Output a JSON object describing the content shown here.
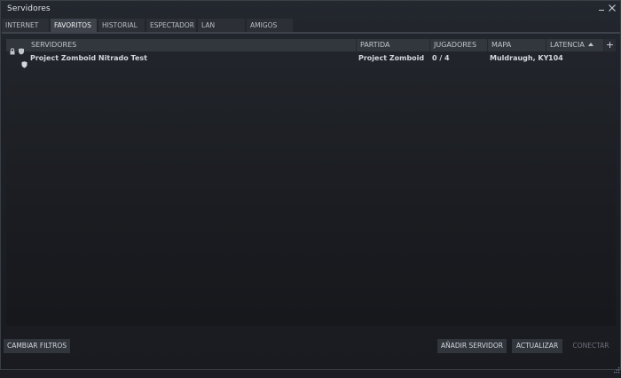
{
  "window": {
    "title": "Servidores"
  },
  "tabs": [
    {
      "label": "INTERNET",
      "active": false
    },
    {
      "label": "FAVORITOS",
      "active": true
    },
    {
      "label": "HISTORIAL",
      "active": false
    },
    {
      "label": "ESPECTADOR",
      "active": false
    },
    {
      "label": "LAN",
      "active": false
    },
    {
      "label": "AMIGOS",
      "active": false
    }
  ],
  "columns": {
    "servidores": "SERVIDORES",
    "partida": "PARTIDA",
    "jugadores": "JUGADORES",
    "mapa": "MAPA",
    "latencia": "LATENCIA",
    "add": "+"
  },
  "servers": [
    {
      "name": "Project Zomboid Nitrado Test",
      "game": "Project Zomboid",
      "players": "0 / 4",
      "map": "Muldraugh, KY",
      "latency": "104"
    }
  ],
  "footer": {
    "change_filters": "CAMBIAR FILTROS",
    "add_server": "AÑADIR SERVIDOR",
    "refresh": "ACTUALIZAR",
    "connect": "CONECTAR"
  },
  "icons": {
    "lock": "lock-icon",
    "shield": "shield-icon",
    "close": "close-icon",
    "minimize": "minimize-icon",
    "sort": "sort-ascending-icon",
    "resize": "resize-grip-icon"
  },
  "colors": {
    "background": "#1b1d22",
    "tab_active": "#3e434b",
    "tab_inactive": "#2c3036",
    "header": "#32363d",
    "button": "#31353c",
    "text": "#c6cbd2",
    "text_disabled": "#6b7078"
  }
}
